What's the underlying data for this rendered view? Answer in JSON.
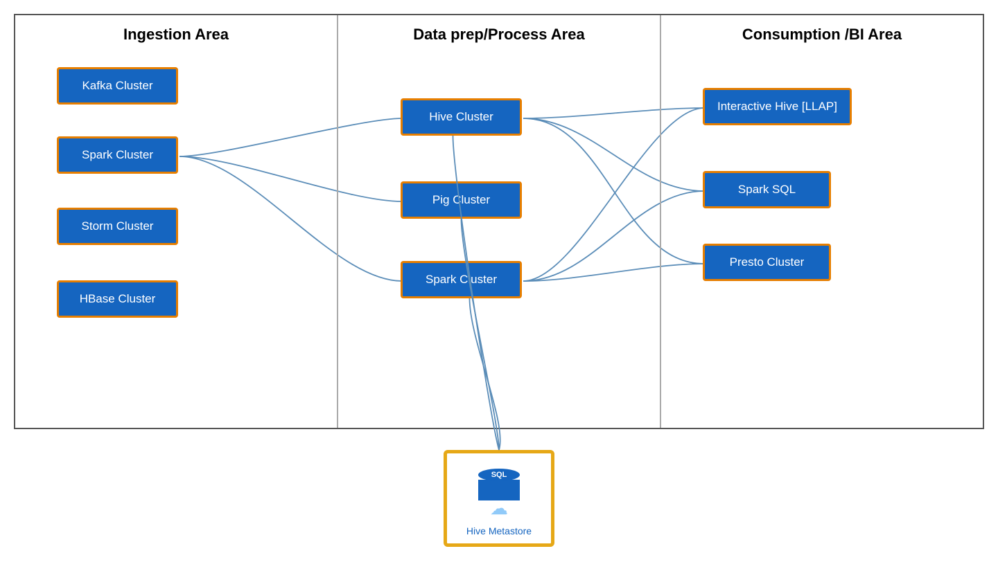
{
  "columns": [
    {
      "id": "ingestion",
      "header": "Ingestion Area"
    },
    {
      "id": "process",
      "header": "Data prep/Process Area"
    },
    {
      "id": "consumption",
      "header": "Consumption /BI Area"
    }
  ],
  "ingestion_boxes": [
    {
      "id": "kafka",
      "label": "Kafka Cluster"
    },
    {
      "id": "spark-ing",
      "label": "Spark Cluster"
    },
    {
      "id": "storm",
      "label": "Storm Cluster"
    },
    {
      "id": "hbase",
      "label": "HBase Cluster"
    }
  ],
  "process_boxes": [
    {
      "id": "hive-proc",
      "label": "Hive Cluster"
    },
    {
      "id": "pig-proc",
      "label": "Pig Cluster"
    },
    {
      "id": "spark-proc",
      "label": "Spark Cluster"
    }
  ],
  "consumption_boxes": [
    {
      "id": "int-hive",
      "label": "Interactive Hive [LLAP]"
    },
    {
      "id": "spark-sql",
      "label": "Spark SQL"
    },
    {
      "id": "presto",
      "label": "Presto Cluster"
    }
  ],
  "metastore": {
    "label": "Hive Metastore",
    "sql_text": "SQL"
  }
}
